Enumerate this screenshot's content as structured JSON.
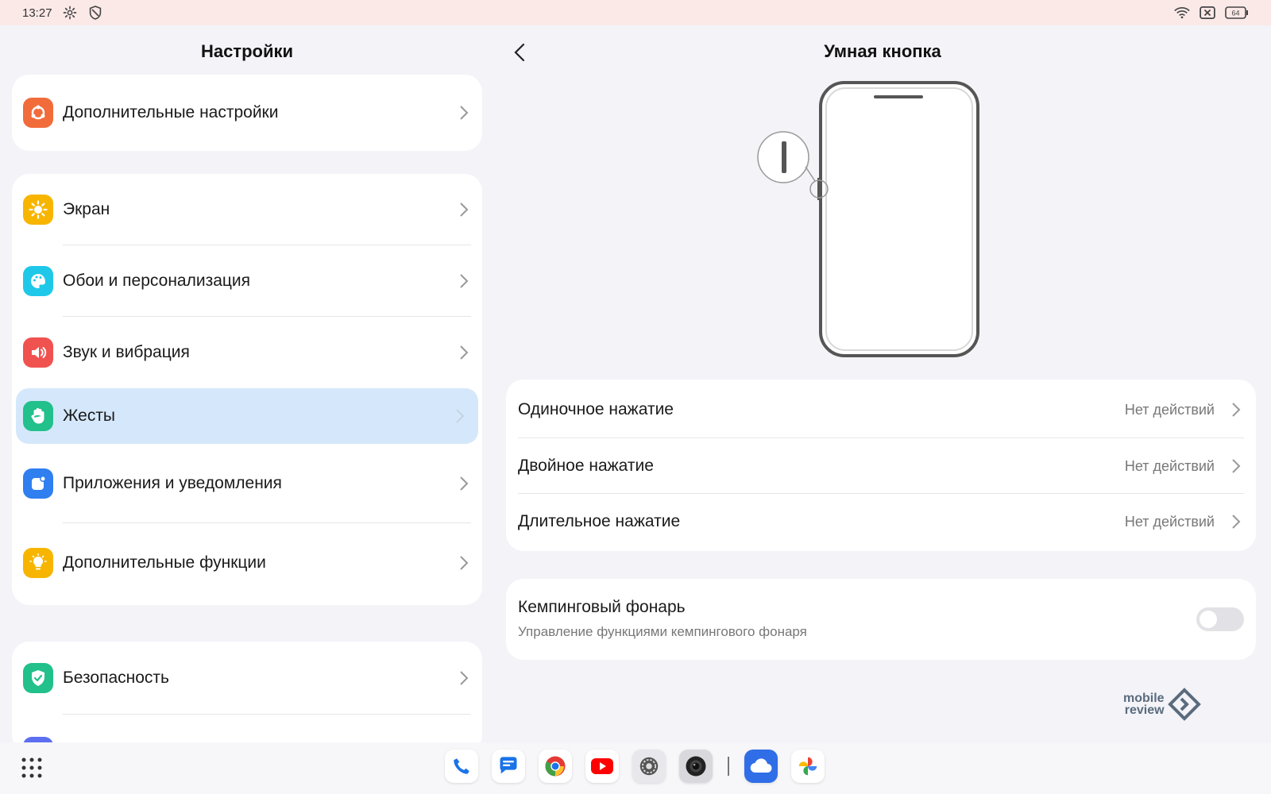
{
  "status_bar": {
    "time": "13:27",
    "icons_left": [
      "gear-icon",
      "shield-icon"
    ],
    "icons_right": [
      "wifi-icon",
      "sim-off-icon",
      "battery-icon"
    ],
    "battery_level": "64"
  },
  "settings": {
    "title": "Настройки",
    "groups": [
      {
        "items": [
          {
            "label": "Дополнительные настройки",
            "icon": "advanced-settings-icon",
            "color": "#f26b3a"
          }
        ]
      },
      {
        "items": [
          {
            "label": "Экран",
            "icon": "sun-icon",
            "color": "#f7b500"
          },
          {
            "label": "Обои и персонализация",
            "icon": "palette-icon",
            "color": "#1fc8e8"
          },
          {
            "label": "Звук и вибрация",
            "icon": "speaker-icon",
            "color": "#f0524f"
          },
          {
            "label": "Жесты",
            "icon": "hand-icon",
            "color": "#22c08b",
            "selected": true
          },
          {
            "label": "Приложения и уведомления",
            "icon": "apps-icon",
            "color": "#2f7ff0"
          },
          {
            "label": "Дополнительные функции",
            "icon": "bulb-icon",
            "color": "#f7b500"
          }
        ]
      },
      {
        "items": [
          {
            "label": "Безопасность",
            "icon": "security-shield-icon",
            "color": "#22c08b"
          }
        ]
      }
    ]
  },
  "detail": {
    "title": "Умная кнопка",
    "press_actions": [
      {
        "label": "Одиночное нажатие",
        "value": "Нет действий"
      },
      {
        "label": "Двойное нажатие",
        "value": "Нет действий"
      },
      {
        "label": "Длительное нажатие",
        "value": "Нет действий"
      }
    ],
    "flashlight": {
      "label": "Кемпинговый фонарь",
      "description": "Управление функциями кемпингового фонаря",
      "enabled": false
    }
  },
  "watermark": {
    "line1": "mobile",
    "line2": "review"
  },
  "dock": {
    "apps": [
      "phone-icon",
      "messages-icon",
      "chrome-icon",
      "youtube-icon",
      "settings-icon",
      "camera-icon",
      "cloud-icon",
      "photos-icon"
    ]
  },
  "colors": {
    "accent_selected": "#d5e8fb",
    "status_bar_bg": "#fbe9e8",
    "background": "#f3f3f8"
  }
}
